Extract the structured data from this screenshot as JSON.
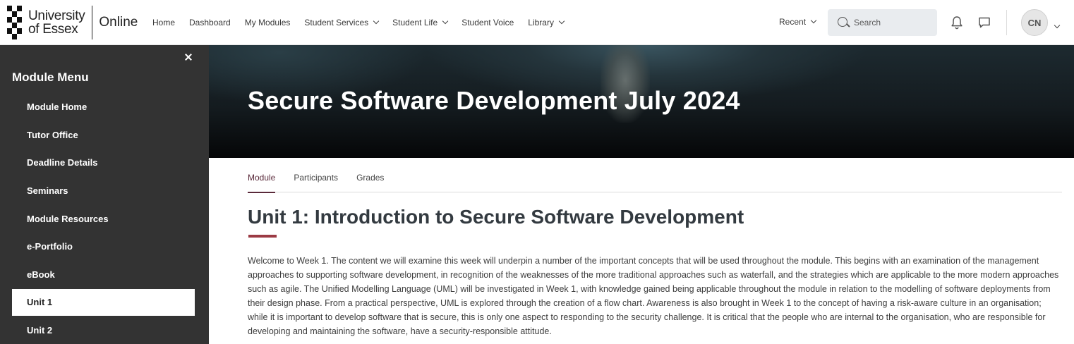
{
  "brand": {
    "university": "University of Essex",
    "university_line1": "University",
    "university_line2": "of Essex",
    "product": "Online"
  },
  "nav": {
    "items": [
      {
        "label": "Home",
        "dropdown": false
      },
      {
        "label": "Dashboard",
        "dropdown": false
      },
      {
        "label": "My Modules",
        "dropdown": false
      },
      {
        "label": "Student Services",
        "dropdown": true
      },
      {
        "label": "Student Life",
        "dropdown": true
      },
      {
        "label": "Student Voice",
        "dropdown": false
      },
      {
        "label": "Library",
        "dropdown": true
      }
    ],
    "recent_label": "Recent",
    "search_placeholder": "Search",
    "user_initials": "CN"
  },
  "sidebar": {
    "title": "Module Menu",
    "items": [
      {
        "label": "Module Home",
        "active": false
      },
      {
        "label": "Tutor Office",
        "active": false
      },
      {
        "label": "Deadline Details",
        "active": false
      },
      {
        "label": "Seminars",
        "active": false
      },
      {
        "label": "Module Resources",
        "active": false
      },
      {
        "label": "e-Portfolio",
        "active": false
      },
      {
        "label": "eBook",
        "active": false
      },
      {
        "label": "Unit 1",
        "active": true
      },
      {
        "label": "Unit 2",
        "active": false
      }
    ]
  },
  "hero": {
    "title": "Secure Software Development July 2024"
  },
  "tabs": [
    {
      "label": "Module",
      "active": true
    },
    {
      "label": "Participants",
      "active": false
    },
    {
      "label": "Grades",
      "active": false
    }
  ],
  "content": {
    "heading": "Unit 1: Introduction to Secure Software Development",
    "intro": "Welcome to Week 1. The content we will examine this week will underpin a number of the important concepts that will be used throughout the module. This begins with an examination of the management approaches to supporting software development, in recognition of the weaknesses of the more traditional approaches such as waterfall, and the strategies which are applicable to the more modern approaches such as agile. The Unified Modelling Language (UML) will be investigated in Week 1, with knowledge gained being applicable throughout the module in relation to the modelling of software deployments from their design phase. From a practical perspective, UML is explored through the creation of a flow chart. Awareness is also brought in Week 1 to the concept of having a risk-aware culture in an organisation; while it is important to develop software that is secure, this is only one aspect to responding to the security challenge. It is critical that the people who are internal to the organisation, who are responsible for developing and maintaining the software, have a security-responsible attitude."
  },
  "colors": {
    "sidebar_bg": "#333333",
    "accent": "#9b3a44",
    "tab_active": "#5a2a3a"
  }
}
